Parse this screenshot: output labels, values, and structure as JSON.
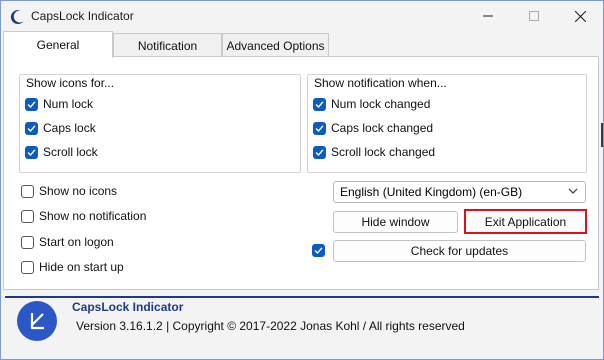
{
  "window": {
    "title": "CapsLock Indicator"
  },
  "tabs": [
    {
      "label": "General",
      "active": true
    },
    {
      "label": "Notification",
      "active": false
    },
    {
      "label": "Advanced Options",
      "active": false
    }
  ],
  "show_icons_group": {
    "title": "Show icons for...",
    "items": [
      {
        "label": "Num lock",
        "checked": true
      },
      {
        "label": "Caps lock",
        "checked": true
      },
      {
        "label": "Scroll lock",
        "checked": true
      }
    ]
  },
  "show_notification_group": {
    "title": "Show notification when...",
    "items": [
      {
        "label": "Num lock changed",
        "checked": true
      },
      {
        "label": "Caps lock changed",
        "checked": true
      },
      {
        "label": "Scroll lock changed",
        "checked": true
      }
    ]
  },
  "options": [
    {
      "label": "Show no icons",
      "checked": false
    },
    {
      "label": "Show no notification",
      "checked": false
    },
    {
      "label": "Start on logon",
      "checked": false
    },
    {
      "label": "Hide on start up",
      "checked": false
    }
  ],
  "language_select": {
    "value": "English (United Kingdom) (en-GB)"
  },
  "buttons": {
    "hide_window": "Hide window",
    "exit_application": "Exit Application",
    "check_updates": "Check for updates",
    "check_updates_checkbox": true
  },
  "footer": {
    "app_name": "CapsLock Indicator",
    "version_line": "Version 3.16.1.2 | Copyright © 2017-2022 Jonas Kohl / All rights reserved"
  },
  "colors": {
    "accent": "#0a5cc4",
    "brand": "#1d3a8a",
    "highlight_border": "#e0101a"
  }
}
